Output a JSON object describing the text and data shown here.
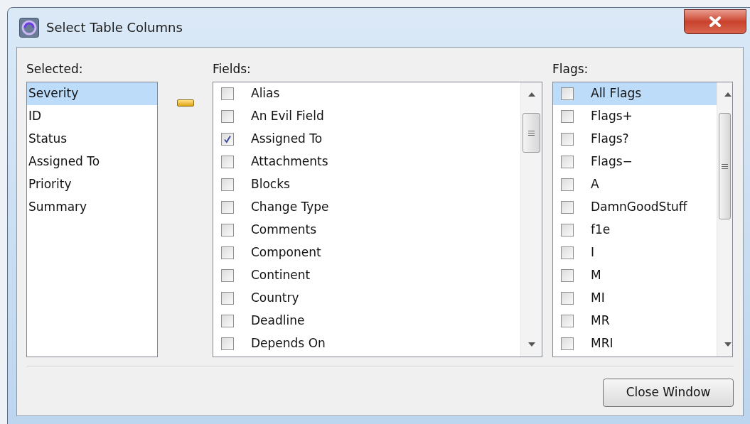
{
  "window": {
    "title": "Select Table Columns"
  },
  "selected": {
    "label": "Selected:",
    "items": [
      {
        "label": "Severity",
        "selected": true
      },
      {
        "label": "ID",
        "selected": false
      },
      {
        "label": "Status",
        "selected": false
      },
      {
        "label": "Assigned To",
        "selected": false
      },
      {
        "label": "Priority",
        "selected": false
      },
      {
        "label": "Summary",
        "selected": false
      }
    ]
  },
  "fields": {
    "label": "Fields:",
    "items": [
      {
        "label": "Alias",
        "checked": false,
        "selected": false
      },
      {
        "label": "An Evil Field",
        "checked": false,
        "selected": false
      },
      {
        "label": "Assigned To",
        "checked": true,
        "selected": false
      },
      {
        "label": "Attachments",
        "checked": false,
        "selected": false
      },
      {
        "label": "Blocks",
        "checked": false,
        "selected": false
      },
      {
        "label": "Change Type",
        "checked": false,
        "selected": false
      },
      {
        "label": "Comments",
        "checked": false,
        "selected": false
      },
      {
        "label": "Component",
        "checked": false,
        "selected": false
      },
      {
        "label": "Continent",
        "checked": false,
        "selected": false
      },
      {
        "label": "Country",
        "checked": false,
        "selected": false
      },
      {
        "label": "Deadline",
        "checked": false,
        "selected": false
      },
      {
        "label": "Depends On",
        "checked": false,
        "selected": false
      }
    ]
  },
  "flags": {
    "label": "Flags:",
    "items": [
      {
        "label": "All Flags",
        "checked": false,
        "selected": true
      },
      {
        "label": "Flags+",
        "checked": false,
        "selected": false
      },
      {
        "label": "Flags?",
        "checked": false,
        "selected": false
      },
      {
        "label": "Flags−",
        "checked": false,
        "selected": false
      },
      {
        "label": "A",
        "checked": false,
        "selected": false
      },
      {
        "label": "DamnGoodStuff",
        "checked": false,
        "selected": false
      },
      {
        "label": "f1e",
        "checked": false,
        "selected": false
      },
      {
        "label": "I",
        "checked": false,
        "selected": false
      },
      {
        "label": "M",
        "checked": false,
        "selected": false
      },
      {
        "label": "MI",
        "checked": false,
        "selected": false
      },
      {
        "label": "MR",
        "checked": false,
        "selected": false
      },
      {
        "label": "MRI",
        "checked": false,
        "selected": false
      }
    ]
  },
  "buttons": [
    {
      "label": "Close Window"
    }
  ]
}
